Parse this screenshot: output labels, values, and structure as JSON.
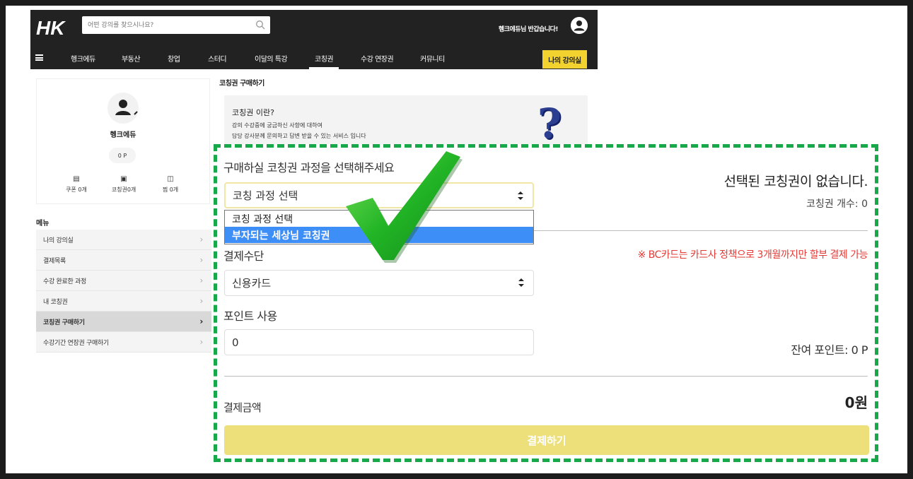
{
  "header": {
    "logo_text": "HK",
    "search_placeholder": "어떤 강의를 찾으시나요?",
    "welcome": "헹크에듀님 반갑습니다!",
    "nav": [
      "헹크에듀",
      "부동산",
      "창업",
      "스터디",
      "이달의 특강",
      "코칭권",
      "수강 연장권",
      "커뮤니티"
    ],
    "active_nav": "코칭권",
    "my_class_button": "나의 강의실"
  },
  "profile": {
    "name": "헹크에듀",
    "point": "0 P",
    "stats": [
      {
        "icon": "coupon-icon",
        "label": "쿠폰 0개"
      },
      {
        "icon": "coaching-ticket-icon",
        "label": "코칭권0개"
      },
      {
        "icon": "basket-icon",
        "label": "찜 0개"
      }
    ]
  },
  "menu": {
    "title": "메뉴",
    "items": [
      {
        "label": "나의 강의실",
        "active": false
      },
      {
        "label": "결제목록",
        "active": false
      },
      {
        "label": "수강 완료한 과정",
        "active": false
      },
      {
        "label": "내 코칭권",
        "active": false
      },
      {
        "label": "코칭권 구매하기",
        "active": true
      },
      {
        "label": "수강기간 연장권 구매하기",
        "active": false
      }
    ]
  },
  "page": {
    "title": "코칭권 구매하기",
    "info_title": "코칭권 이란?",
    "info_line1": "강의 수강중에 궁금하신 사항에 대하여",
    "info_line2": "담당 강사분께 문의하고 답변 받을 수 있는 서비스 입니다",
    "info_symbol": "?"
  },
  "panel": {
    "course_label": "구매하실 코칭권 과정을 선택해주세요",
    "course_select_value": "코칭 과정 선택",
    "course_options": [
      "코칭 과정 선택",
      "부자되는 세상님 코칭권"
    ],
    "highlighted_option": 1,
    "selected_status": "선택된 코칭권이 없습니다.",
    "coaching_count": "코칭권 개수: 0",
    "payment_method_label": "결제수단",
    "bc_card_note": "※ BC카드는 카드사 정책으로 3개월까지만 할부 결제 가능",
    "payment_method_value": "신용카드",
    "point_label": "포인트 사용",
    "point_value": "0",
    "remaining_points": "잔여 포인트: 0 P",
    "amount_label": "결제금액",
    "amount_value": "0원",
    "pay_button": "결제하기"
  },
  "colors": {
    "header_bg": "#222222",
    "accent_yellow": "#f2d22f",
    "pay_button": "#ede07b",
    "dashed_border": "#17a84a",
    "highlight_blue": "#3e8ef7",
    "notice_red": "#e53935",
    "checkmark": "#22b526"
  }
}
